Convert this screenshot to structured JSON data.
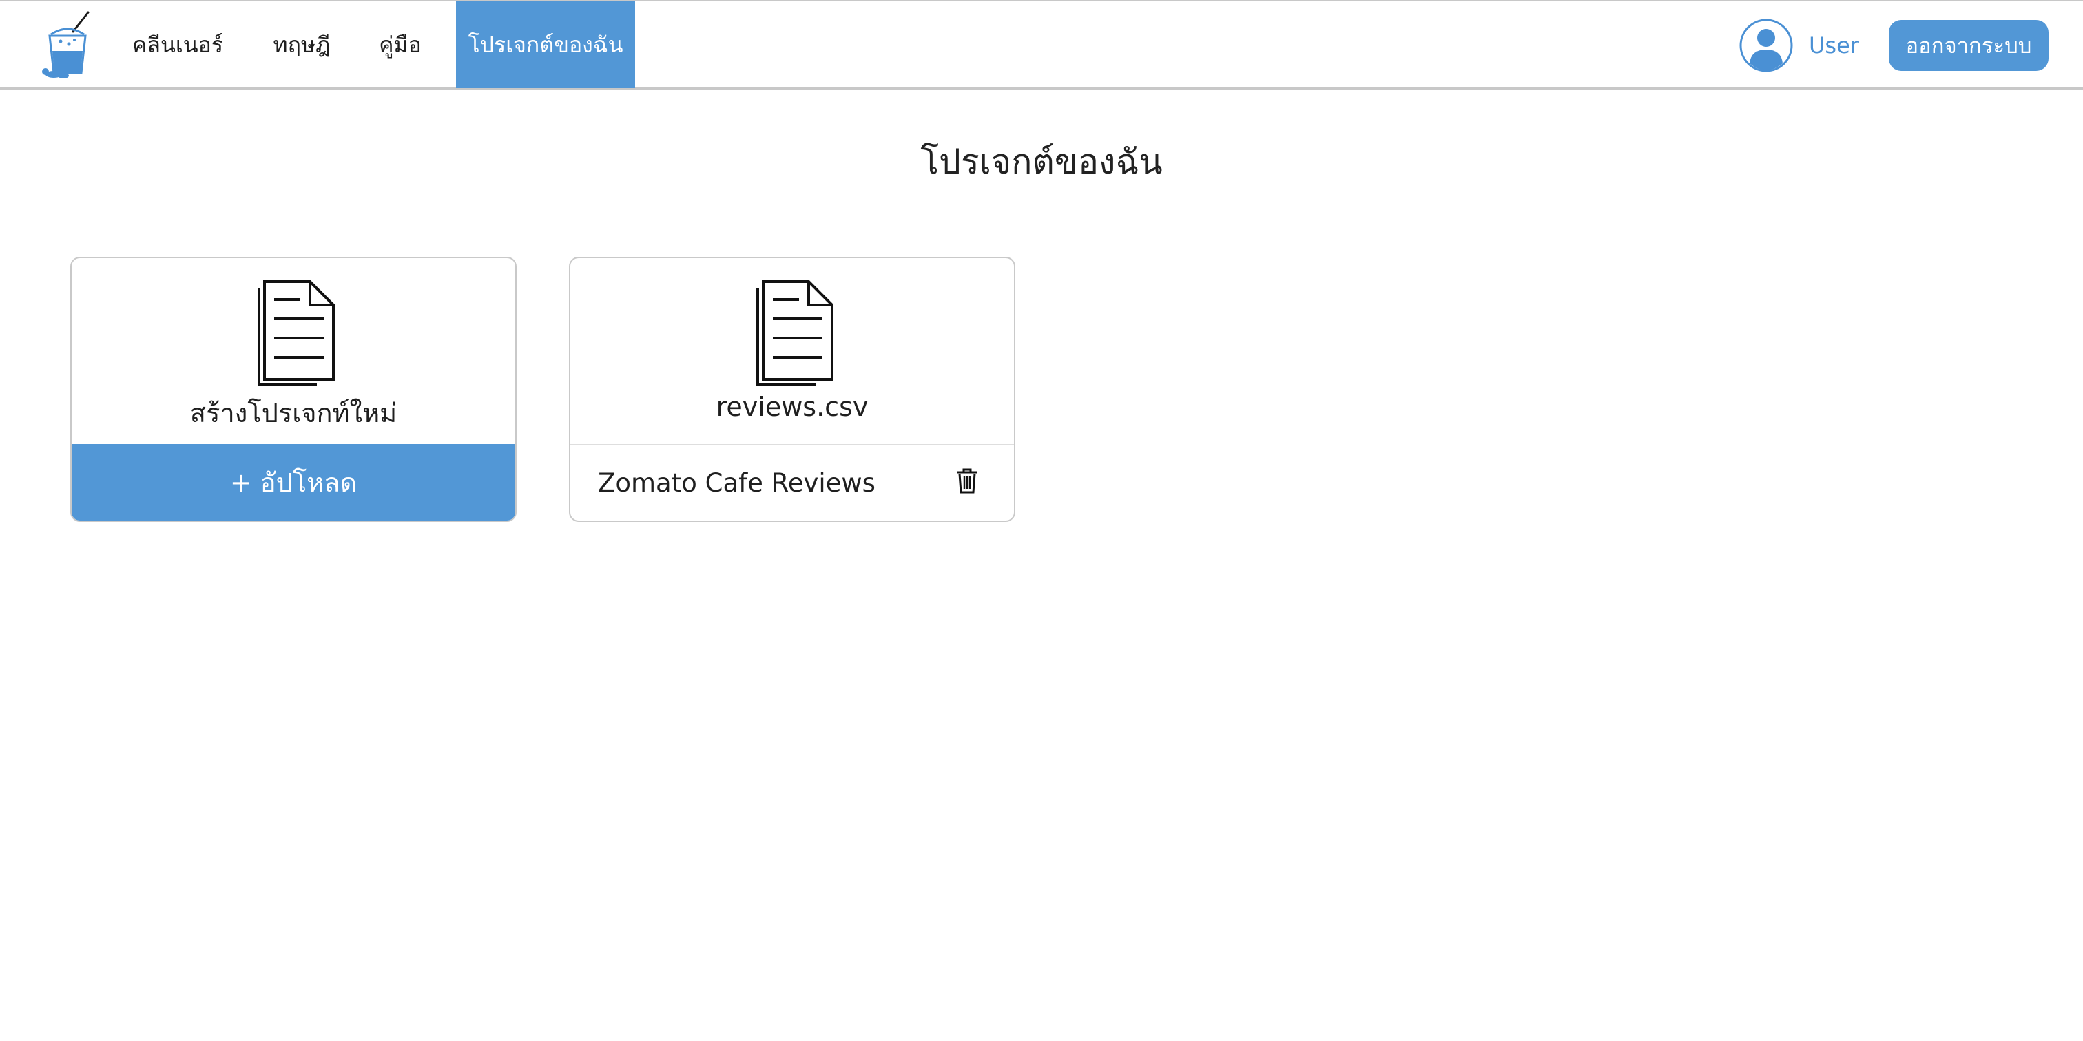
{
  "header": {
    "logo_icon": "smoothie-cup-logo-icon",
    "nav": [
      {
        "label": "คลีนเนอร์",
        "active": false
      },
      {
        "label": "ทฤษฎี",
        "active": false
      },
      {
        "label": "คู่มือ",
        "active": false
      },
      {
        "label": "โปรเจกต์ของฉัน",
        "active": true
      }
    ],
    "user": {
      "icon": "user-avatar-icon",
      "name": "User"
    },
    "logout_label": "ออกจากระบบ"
  },
  "main": {
    "title": "โปรเจกต์ของฉัน",
    "new_project_card": {
      "icon": "document-icon",
      "title": "สร้างโปรเจกท์ใหม่",
      "upload_label": "+ อัปโหลด"
    },
    "projects": [
      {
        "icon": "document-icon",
        "file_name": "reviews.csv",
        "project_name": "Zomato Cafe Reviews",
        "delete_icon": "trash-icon"
      }
    ]
  },
  "colors": {
    "accent": "#5297d6",
    "user_text": "#4a90d4",
    "border": "#c9c9c9"
  }
}
